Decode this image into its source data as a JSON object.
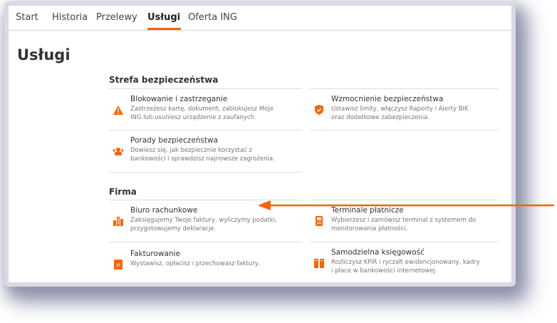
{
  "colors": {
    "accent": "#ff6200",
    "text": "#333333",
    "muted": "#777777"
  },
  "nav": {
    "items": [
      {
        "label": "Start"
      },
      {
        "label": "Historia"
      },
      {
        "label": "Przelewy"
      },
      {
        "label": "Usługi"
      },
      {
        "label": "Oferta ING"
      }
    ],
    "active": "Usługi"
  },
  "page": {
    "title": "Usługi"
  },
  "sections": [
    {
      "title": "Strefa bezpieczeństwa",
      "items": [
        {
          "icon": "warning-icon",
          "title": "Blokowanie i zastrzeganie",
          "desc": "Zastrzeżesz kartę, dokument, zablokujesz Moje ING lub usuniesz urządzenie z zaufanych."
        },
        {
          "icon": "shield-icon",
          "title": "Wzmocnienie bezpieczeństwa",
          "desc": "Ustawisz limity, włączysz Raporty i Alerty BIK oraz dodatkowe zabezpieczenia."
        },
        {
          "icon": "advice-icon",
          "title": "Porady bezpieczeństwa",
          "desc": "Dowiesz się, jak bezpiecznie korzystać z bankowości i sprawdzisz najnowsze zagrożenia."
        }
      ]
    },
    {
      "title": "Firma",
      "items": [
        {
          "icon": "accounting-office-icon",
          "title": "Biuro rachunkowe",
          "desc": "Zaksięgujemy Twoje faktury, wyliczymy podatki, przygotowujemy deklaracje."
        },
        {
          "icon": "payment-terminal-icon",
          "title": "Terminale płatnicze",
          "desc": "Wybierzesz i zamówisz terminal z systemem do monitorowania płatności."
        },
        {
          "icon": "invoice-icon",
          "title": "Fakturowanie",
          "desc": "Wystawisz, opłacisz i przechowasz faktury."
        },
        {
          "icon": "bookkeeping-icon",
          "title": "Samodzielna księgowość",
          "desc": "Rozliczysz KPiR i ryczałt ewidencjonowany, kadry i płace w bankowości internetowej."
        }
      ]
    }
  ]
}
